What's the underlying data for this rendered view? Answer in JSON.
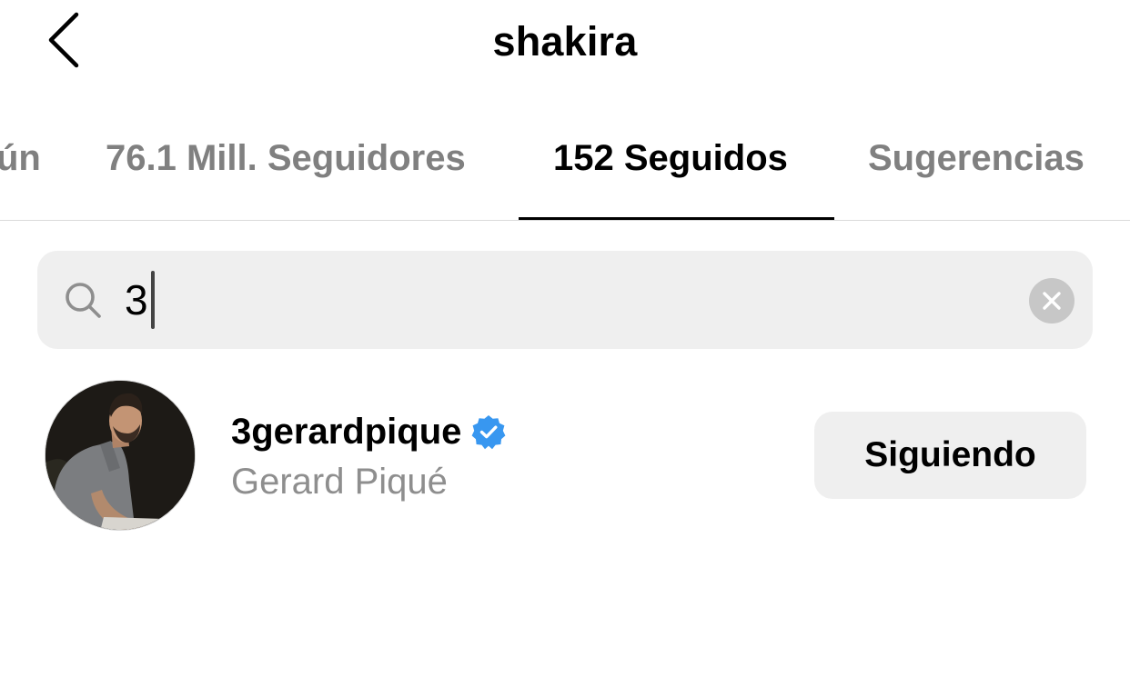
{
  "header": {
    "title": "shakira",
    "back_icon": "chevron-left-icon"
  },
  "tabs": [
    {
      "label": "ún",
      "active": false
    },
    {
      "label": "76.1 Mill. Seguidores",
      "active": false
    },
    {
      "label": "152 Seguidos",
      "active": true
    },
    {
      "label": "Sugerencias",
      "active": false
    }
  ],
  "search": {
    "value": "3",
    "icon": "search-icon",
    "clear_icon": "clear-icon"
  },
  "results": [
    {
      "username": "3gerardpique",
      "verified": true,
      "full_name": "Gerard Piqué",
      "button_label": "Siguiendo"
    }
  ],
  "colors": {
    "text_primary": "#000000",
    "text_secondary": "#8e8e8e",
    "search_bg": "#efefef",
    "button_bg": "#efefef",
    "verified_badge": "#3897f0",
    "divider": "#dbdbdb"
  }
}
